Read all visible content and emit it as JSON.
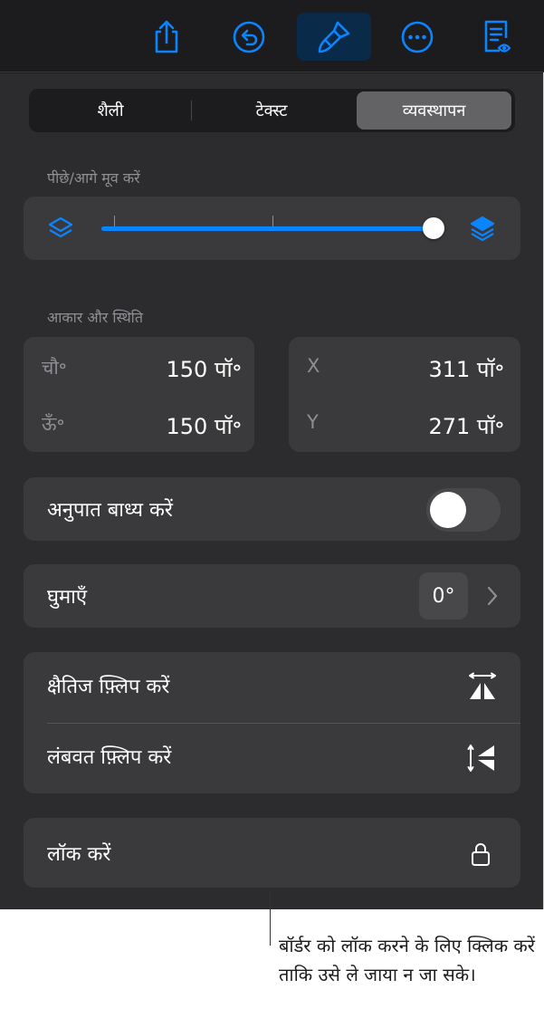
{
  "toolbar": {
    "buttons": [
      {
        "icon": "share-icon"
      },
      {
        "icon": "undo-icon"
      },
      {
        "icon": "format-brush-icon",
        "active": true
      },
      {
        "icon": "more-icon"
      },
      {
        "icon": "reader-view-icon"
      }
    ],
    "accent_color": "#0a84ff"
  },
  "tabs": {
    "items": [
      "शैली",
      "टेक्स्ट",
      "व्यवस्थापन"
    ],
    "selected": "व्यवस्थापन"
  },
  "arrange": {
    "section_label": "पीछे/आगे मूव करें",
    "slider_value": 1.0
  },
  "size_position": {
    "section_label": "आकार और स्थिति",
    "width_label": "चौ॰",
    "width_value": "150 पॉ॰",
    "height_label": "ऊँ॰",
    "height_value": "150 पॉ॰",
    "x_label": "X",
    "x_value": "311 पॉ॰",
    "y_label": "Y",
    "y_value": "271 पॉ॰"
  },
  "constrain": {
    "label": "अनुपात बाध्य करें",
    "on": false
  },
  "rotate": {
    "label": "घुमाएँ",
    "value": "0°"
  },
  "flip": {
    "horizontal_label": "क्षैतिज फ़्लिप करें",
    "vertical_label": "लंबवत फ़्लिप करें"
  },
  "lock": {
    "label": "लॉक करें"
  },
  "callout": {
    "text": "बॉर्डर को लॉक करने के लिए क्लिक करें ताकि उसे ले जाया न जा सके।"
  }
}
